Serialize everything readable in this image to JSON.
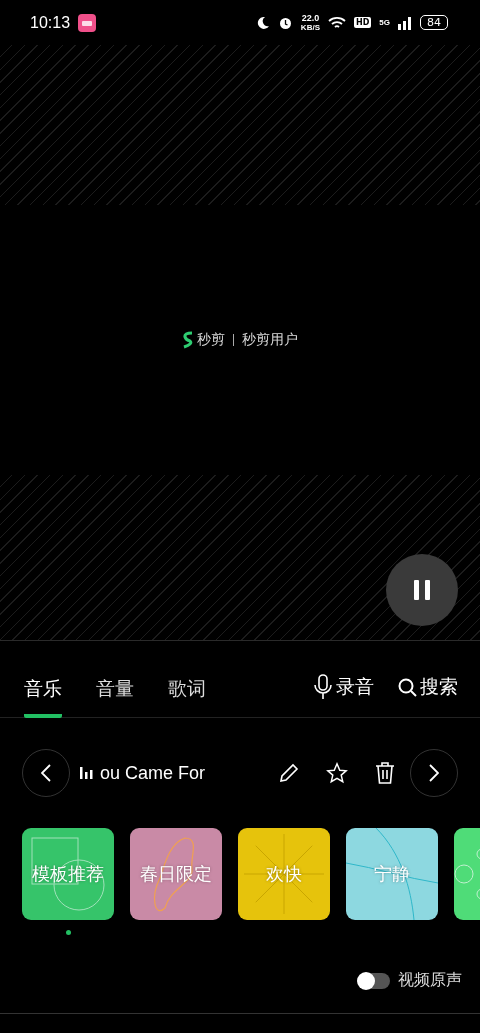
{
  "status_bar": {
    "time": "10:13",
    "speed": "22.0",
    "speed_unit": "KB/S",
    "hd": "HD",
    "network": "5G",
    "battery": "84"
  },
  "preview": {
    "logo_text": "秒剪",
    "user": "秒剪用户",
    "playing": true
  },
  "tabs": [
    {
      "label": "音乐",
      "selected": true
    },
    {
      "label": "音量",
      "selected": false
    },
    {
      "label": "歌词",
      "selected": false
    }
  ],
  "actions": [
    {
      "kind": "record",
      "label": "录音"
    },
    {
      "kind": "search",
      "label": "搜索"
    }
  ],
  "track": {
    "title": "ou Came For",
    "starred": false
  },
  "categories": [
    {
      "label": "模板推荐",
      "color": "#36c46a",
      "kind": "shapes",
      "selected": true
    },
    {
      "label": "春日限定",
      "color": "#c98aa6",
      "kind": "blob",
      "selected": false
    },
    {
      "label": "欢快",
      "color": "#e6c30c",
      "kind": "rays",
      "selected": false
    },
    {
      "label": "宁静",
      "color": "#8dd8e0",
      "kind": "waves",
      "selected": false
    },
    {
      "color": "#4fdc78",
      "kind": "circles",
      "selected": false
    }
  ],
  "original_sound": {
    "label": "视频原声",
    "on": false
  }
}
